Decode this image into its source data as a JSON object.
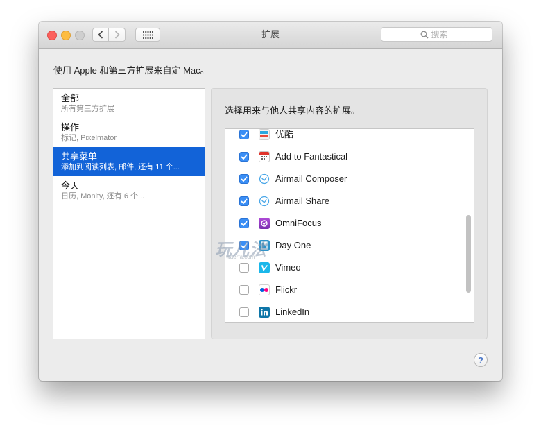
{
  "window": {
    "title": "扩展",
    "search": {
      "placeholder": "搜索"
    },
    "description": "使用 Apple 和第三方扩展来自定 Mac。"
  },
  "sidebar": {
    "items": [
      {
        "name": "全部",
        "subtitle": "所有第三方扩展",
        "selected": false
      },
      {
        "name": "操作",
        "subtitle": "标记, Pixelmator",
        "selected": false
      },
      {
        "name": "共享菜单",
        "subtitle": "添加到阅读列表, 邮件, 还有 11 个...",
        "selected": true
      },
      {
        "name": "今天",
        "subtitle": "日历, Monity, 还有 6 个...",
        "selected": false
      }
    ]
  },
  "panel": {
    "title": "选择用来与他人共享内容的扩展。",
    "extensions": [
      {
        "name": "优酷",
        "checked": true,
        "icon": "youku-icon"
      },
      {
        "name": "Add to Fantastical",
        "checked": true,
        "icon": "fantastical-calendar-icon"
      },
      {
        "name": "Airmail Composer",
        "checked": true,
        "icon": "airmail-icon"
      },
      {
        "name": "Airmail Share",
        "checked": true,
        "icon": "airmail-icon"
      },
      {
        "name": "OmniFocus",
        "checked": true,
        "icon": "omnifocus-icon"
      },
      {
        "name": "Day One",
        "checked": true,
        "icon": "dayone-icon"
      },
      {
        "name": "Vimeo",
        "checked": false,
        "icon": "vimeo-icon"
      },
      {
        "name": "Flickr",
        "checked": false,
        "icon": "flickr-icon"
      },
      {
        "name": "LinkedIn",
        "checked": false,
        "icon": "linkedin-icon"
      }
    ]
  },
  "help_label": "?",
  "watermark": {
    "text": "玩儿法",
    "url": "waerfa.com"
  },
  "colors": {
    "selection": "#1263d8",
    "checkbox_on": "#3a8ef5",
    "close": "#fc605c",
    "minimize": "#fdbc40"
  }
}
